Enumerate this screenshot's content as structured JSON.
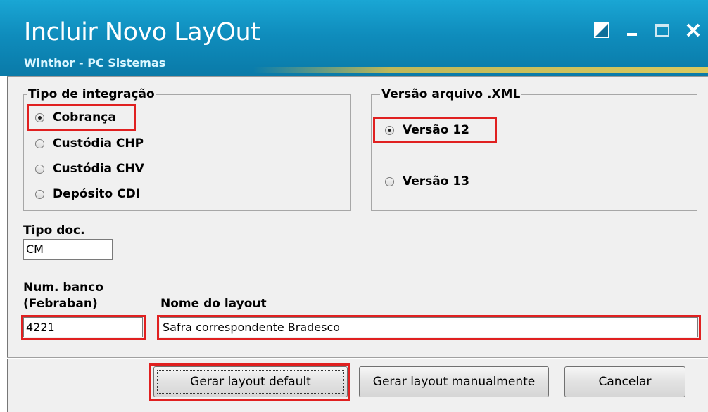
{
  "window": {
    "title": "Incluir Novo LayOut",
    "subtitle": "Winthor - PC Sistemas",
    "controls": [
      "restore-icon",
      "minimize-icon",
      "maximize-icon",
      "close-icon"
    ]
  },
  "tipo_integracao": {
    "legend": "Tipo de integração",
    "options": [
      {
        "label": "Cobrança",
        "selected": true
      },
      {
        "label": "Custódia CHP",
        "selected": false
      },
      {
        "label": "Custódia CHV",
        "selected": false
      },
      {
        "label": "Depósito CDI",
        "selected": false
      }
    ]
  },
  "versao_xml": {
    "legend": "Versão arquivo .XML",
    "options": [
      {
        "label": "Versão 12",
        "selected": true
      },
      {
        "label": "Versão 13",
        "selected": false
      }
    ]
  },
  "tipo_doc": {
    "label": "Tipo doc.",
    "value": "CM"
  },
  "num_banco": {
    "label_line1": "Num. banco",
    "label_line2": "(Febraban)",
    "value": "4221"
  },
  "nome_layout": {
    "label": "Nome do layout",
    "value": "Safra correspondente Bradesco"
  },
  "buttons": {
    "gerar_default": "Gerar layout default",
    "gerar_manual": "Gerar layout manualmente",
    "cancelar": "Cancelar"
  },
  "colors": {
    "titlebar": "#0f8dbd",
    "highlight": "#e02020",
    "panel": "#f0f0f0"
  }
}
